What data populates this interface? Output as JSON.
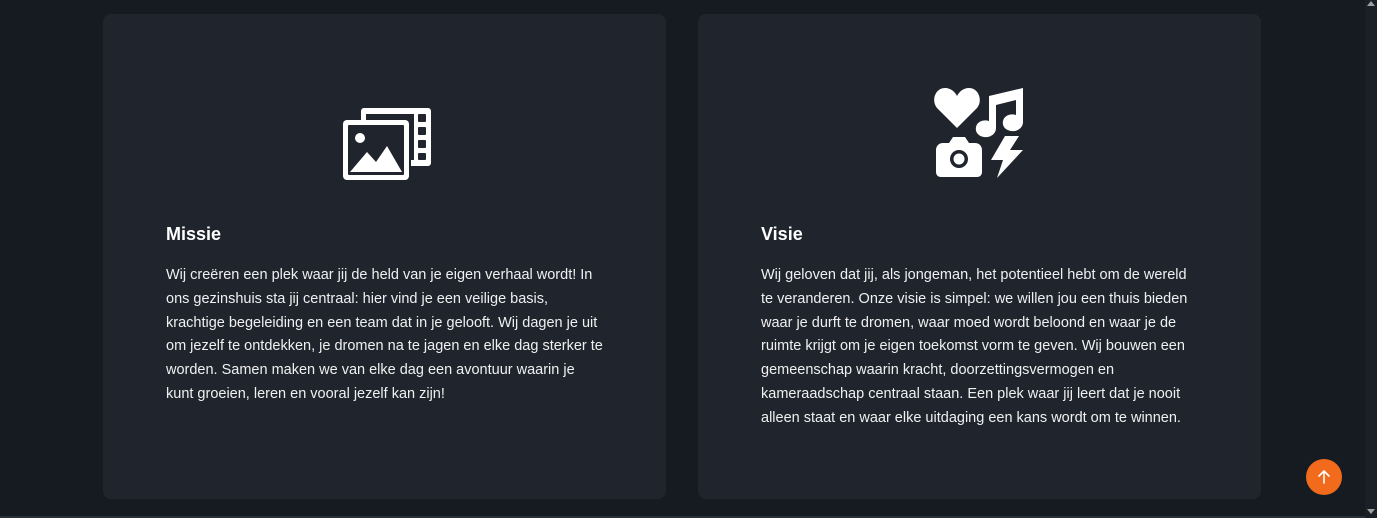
{
  "cards": [
    {
      "icon": "photo-film-icon",
      "title": "Missie",
      "body": "Wij creëren een plek waar jij de held van je eigen verhaal wordt! In ons gezinshuis sta jij centraal: hier vind je een veilige basis, krachtige begeleiding en een team dat in je gelooft. Wij dagen je uit om jezelf te ontdekken, je dromen na te jagen en elke dag sterker te worden. Samen maken we van elke dag een avontuur waarin je kunt groeien, leren en vooral jezelf kan zijn!"
    },
    {
      "icon": "icons-heart-music-camera-bolt-icon",
      "title": "Visie",
      "body": "Wij geloven dat jij, als jongeman, het potentieel hebt om de wereld te veranderen. Onze visie is simpel: we willen jou een thuis bieden waar je durft te dromen, waar moed wordt beloond en waar je de ruimte krijgt om je eigen toekomst vorm te geven. Wij bouwen een gemeenschap waarin kracht, doorzettingsvermogen en kameraadschap centraal staan. Een plek waar jij leert dat je nooit alleen staat en waar elke uitdaging een kans wordt om te winnen."
    }
  ],
  "scroll_top_button": {
    "icon": "arrow-up-icon",
    "color": "#f26a1b"
  },
  "colors": {
    "background": "#161b22",
    "card": "#1f242d",
    "text": "#f0f0f0",
    "accent": "#f26a1b"
  }
}
